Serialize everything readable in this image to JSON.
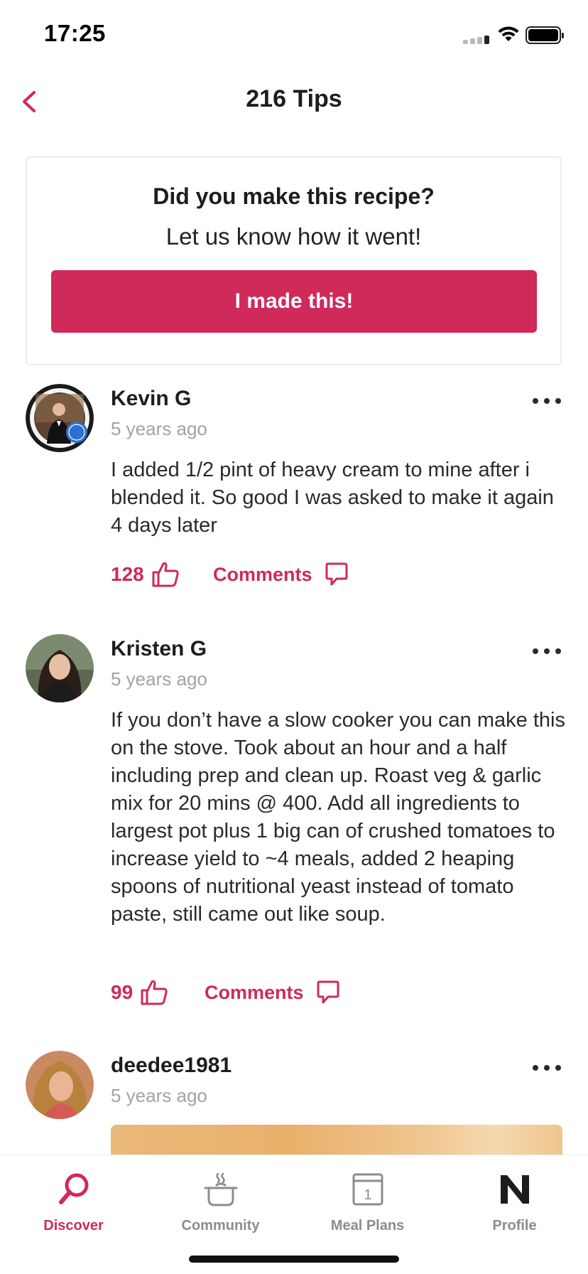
{
  "status_bar": {
    "time": "17:25"
  },
  "header": {
    "title": "216 Tips"
  },
  "prompt": {
    "title": "Did you make this recipe?",
    "subtitle": "Let us know how it went!",
    "button_label": "I made this!"
  },
  "tips": [
    {
      "user": "Kevin G",
      "time": "5 years ago",
      "text": "I added 1/2 pint of heavy cream to mine after i blended it. So good I was asked to make it again 4 days later",
      "likes": "128",
      "comments_label": "Comments"
    },
    {
      "user": "Kristen G",
      "time": "5 years ago",
      "text": "If you don’t have a slow cooker you can make this on the stove. Took about an hour and a half including prep and clean up. Roast veg & garlic mix for 20 mins @ 400. Add all ingredients to largest pot plus 1 big can of crushed tomatoes to increase yield to ~4 meals, added 2 heaping spoons of nutritional yeast instead of tomato paste, still came out like soup.",
      "likes": "99",
      "comments_label": "Comments"
    },
    {
      "user": "deedee1981",
      "time": "5 years ago"
    }
  ],
  "tab_bar": {
    "tabs": [
      {
        "label": "Discover",
        "icon": "discover-icon",
        "active": true
      },
      {
        "label": "Community",
        "icon": "community-icon",
        "active": false
      },
      {
        "label": "Meal Plans",
        "icon": "meal-plans-icon",
        "active": false
      },
      {
        "label": "Profile",
        "icon": "profile-icon",
        "active": false
      }
    ],
    "meal_plans_day": "1"
  },
  "colors": {
    "accent": "#cf2a5a",
    "muted": "#a3a3a3",
    "tab_inactive": "#8c8c8c"
  }
}
